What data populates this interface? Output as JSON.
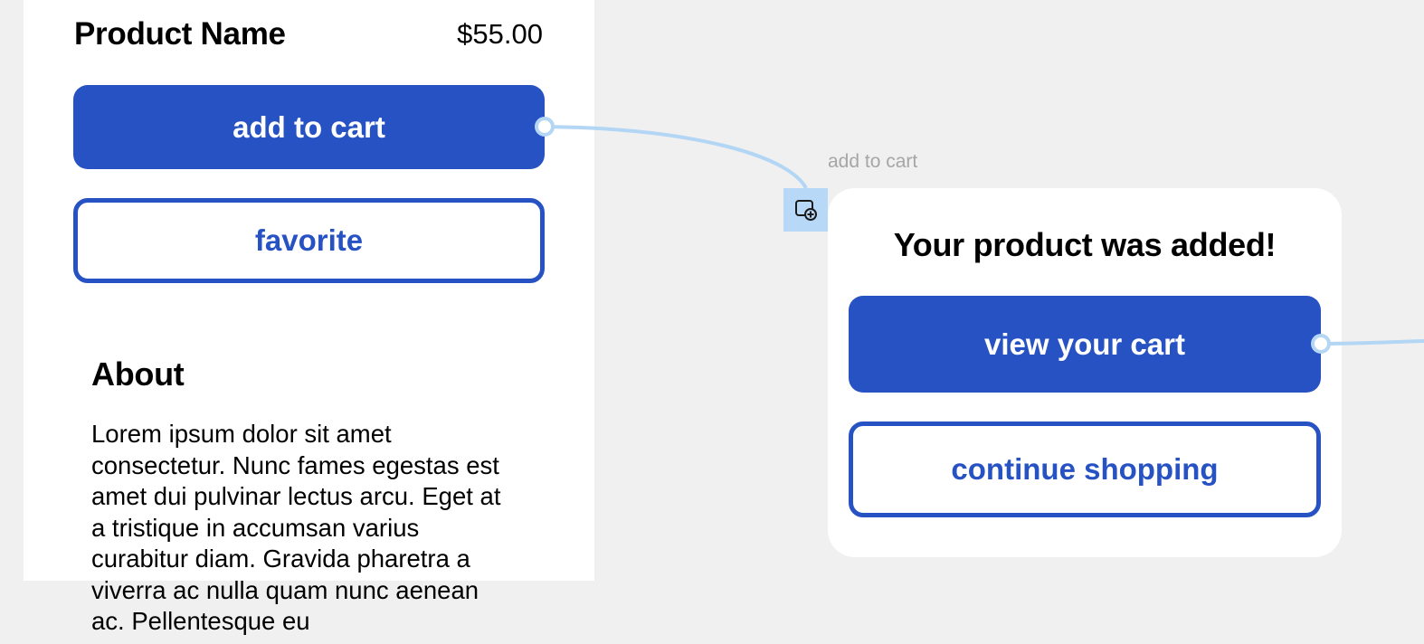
{
  "product_screen": {
    "product_name": "Product Name",
    "price": "$55.00",
    "add_to_cart_label": "add to cart",
    "favorite_label": "favorite",
    "about_heading": "About",
    "about_text": "Lorem ipsum dolor sit amet consectetur. Nunc fames egestas est amet dui pulvinar lectus arcu. Eget at a tristique in accumsan varius curabitur diam. Gravida pharetra a viverra ac nulla quam nunc aenean ac. Pellentesque eu"
  },
  "prototype_connection": {
    "trigger_label": "add to cart",
    "overlay_icon": "overlay-add-icon",
    "connector_color": "#b3d6f5"
  },
  "confirmation_modal": {
    "title": "Your product was added!",
    "view_cart_label": "view your cart",
    "continue_label": "continue shopping"
  },
  "colors": {
    "primary": "#2752c3",
    "canvas": "#f0f0f0",
    "frame": "#ffffff",
    "muted_text": "#a6a6a6"
  }
}
